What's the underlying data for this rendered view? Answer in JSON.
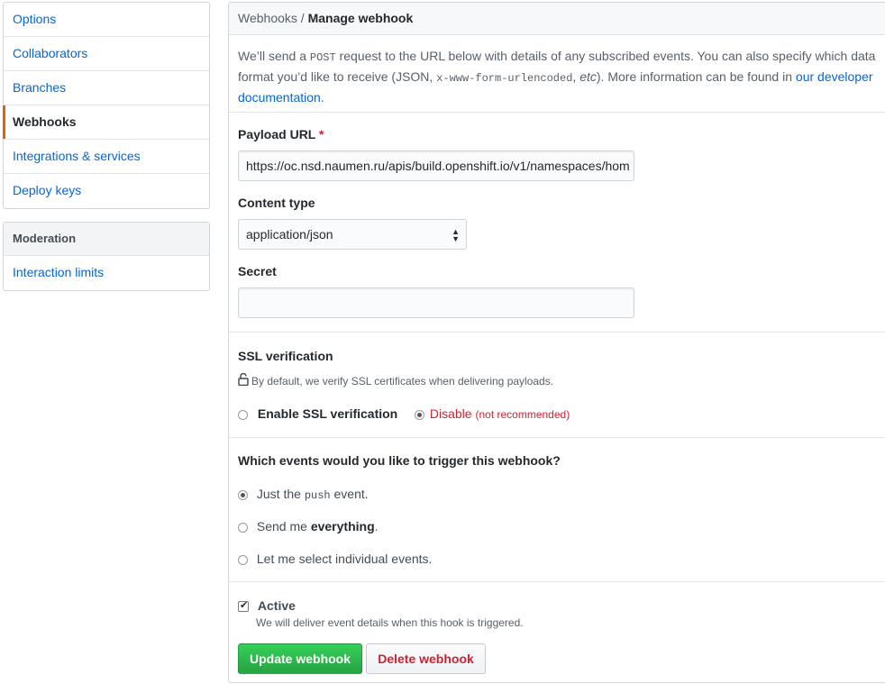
{
  "sidebar": {
    "items": [
      {
        "label": "Options"
      },
      {
        "label": "Collaborators"
      },
      {
        "label": "Branches"
      },
      {
        "label": "Webhooks",
        "selected": true
      },
      {
        "label": "Integrations & services"
      },
      {
        "label": "Deploy keys"
      }
    ],
    "moderation": {
      "heading": "Moderation",
      "items": [
        {
          "label": "Interaction limits"
        }
      ]
    }
  },
  "breadcrumb": {
    "parent": "Webhooks",
    "separator": " / ",
    "current": "Manage webhook"
  },
  "intro": {
    "part1": "We’ll send a ",
    "post": "POST",
    "part2": " request to the URL below with details of any subscribed events. You can also specify which data format you’d like to receive (JSON, ",
    "urlencoded": "x-www-form-urlencoded",
    "part3": ", ",
    "etc": "etc",
    "part4": "). More information can be found in ",
    "link": "our developer documentation",
    "part5": "."
  },
  "form": {
    "payload_url_label": "Payload URL",
    "required_mark": "*",
    "payload_url_value": "https://oc.nsd.naumen.ru/apis/build.openshift.io/v1/namespaces/hom",
    "content_type_label": "Content type",
    "content_type_value": "application/json",
    "secret_label": "Secret",
    "secret_value": ""
  },
  "ssl": {
    "heading": "SSL verification",
    "note": "By default, we verify SSL certificates when delivering payloads.",
    "enable_label": "Enable SSL verification",
    "disable_label": "Disable",
    "disable_note": "(not recommended)",
    "selected": "disable"
  },
  "events": {
    "heading": "Which events would you like to trigger this webhook?",
    "option1_pre": "Just the ",
    "option1_code": "push",
    "option1_post": " event.",
    "option2_pre": "Send me ",
    "option2_bold": "everything",
    "option2_post": ".",
    "option3": "Let me select individual events.",
    "selected": "push"
  },
  "active": {
    "label": "Active",
    "checked": true,
    "note": "We will deliver event details when this hook is triggered."
  },
  "buttons": {
    "update": "Update webhook",
    "delete": "Delete webhook"
  },
  "colors": {
    "link": "#0366d6",
    "selected_accent": "#e36209",
    "danger": "#cb2431",
    "primary": "#28a745"
  }
}
